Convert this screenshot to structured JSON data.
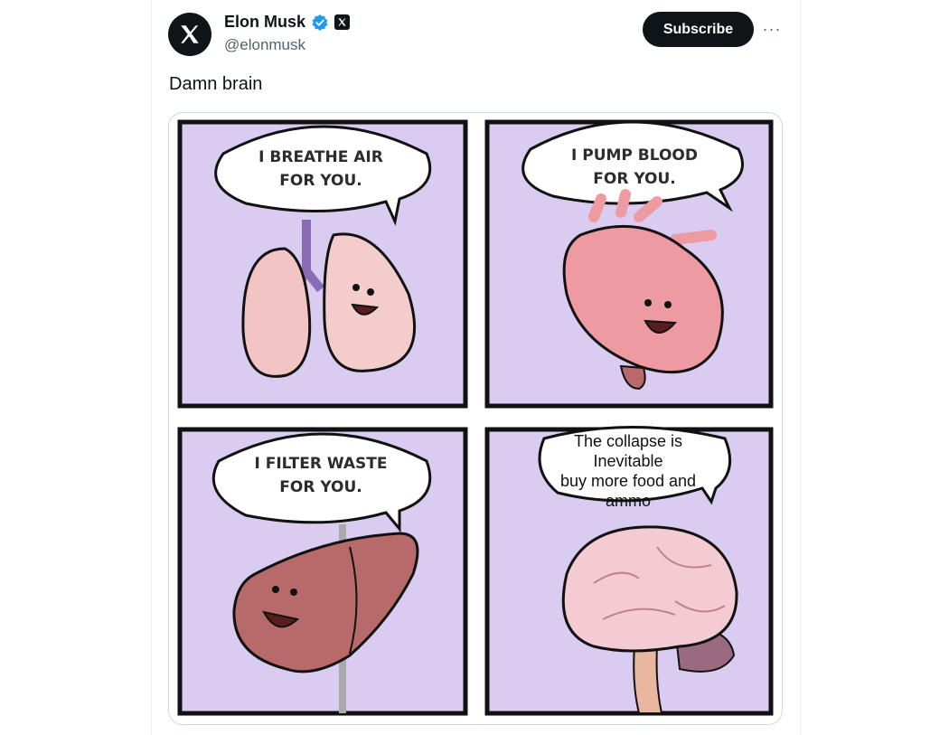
{
  "tweet": {
    "author_name": "Elon Musk",
    "handle": "@elonmusk",
    "subscribe_label": "Subscribe",
    "more_label": "···",
    "text": "Damn brain"
  },
  "meme": {
    "panel1": [
      "I BREATHE AIR",
      "FOR YOU."
    ],
    "panel2": [
      "I PUMP BLOOD",
      "FOR YOU."
    ],
    "panel3": [
      "I FILTER WASTE",
      "FOR YOU."
    ],
    "panel4": [
      "The collapse is",
      "Inevitable",
      "buy more food and",
      "ammo"
    ]
  },
  "colors": {
    "panel_bg": "#d9ccf0",
    "lung": "#f2c4c4",
    "heart": "#ee9aa2",
    "liver": "#b86a6a",
    "brain": "#f4cbd3"
  }
}
